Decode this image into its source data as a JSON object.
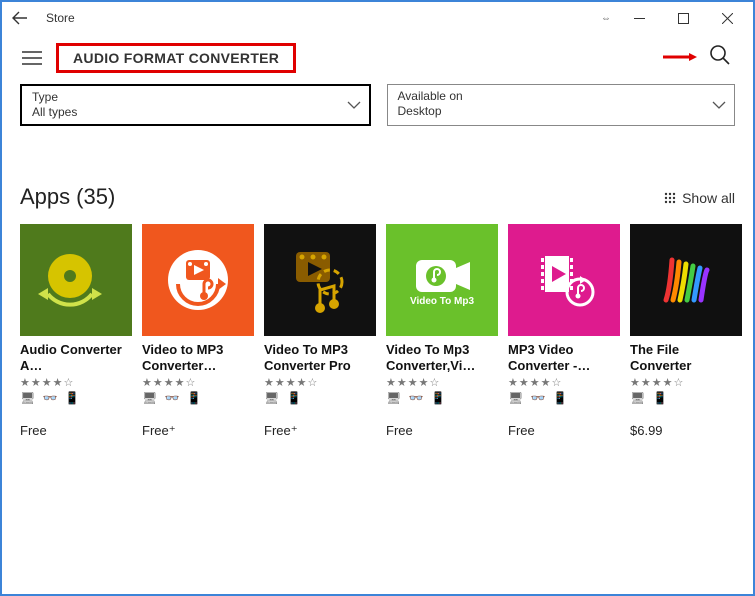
{
  "window": {
    "title": "Store"
  },
  "toolbar": {
    "search_query": "AUDIO FORMAT CONVERTER"
  },
  "filters": {
    "type": {
      "label": "Type",
      "value": "All types"
    },
    "available": {
      "label": "Available on",
      "value": "Desktop"
    }
  },
  "section": {
    "title": "Apps",
    "count": "(35)",
    "show_all": "Show all"
  },
  "apps": [
    {
      "name": "Audio Converter A…",
      "stars": "★★★★☆",
      "devices": "🖥 👓 📱",
      "price": "Free",
      "bg": "#4f7a1c",
      "icon": "disc"
    },
    {
      "name": "Video to MP3 Converter…",
      "stars": "★★★★☆",
      "devices": "🖥 👓 📱",
      "price": "Free⁺",
      "bg": "#f0571e",
      "icon": "film-cycle"
    },
    {
      "name": "Video To MP3 Converter Pro",
      "stars": "★★★★☆",
      "devices": "🖥 📱",
      "price": "Free⁺",
      "bg": "#111111",
      "icon": "film-note"
    },
    {
      "name": "Video To Mp3 Converter,Vi…",
      "stars": "★★★★☆",
      "devices": "🖥 👓 📱",
      "price": "Free",
      "bg": "#6ac12b",
      "icon": "cam-note"
    },
    {
      "name": "MP3 Video Converter -…",
      "stars": "★★★★☆",
      "devices": "🖥 👓 📱",
      "price": "Free",
      "bg": "#de1b8e",
      "icon": "film-loop"
    },
    {
      "name": "The File Converter",
      "stars": "★★★★☆",
      "devices": "🖥 📱",
      "price": "$6.99",
      "bg": "#101010",
      "icon": "bars"
    }
  ]
}
